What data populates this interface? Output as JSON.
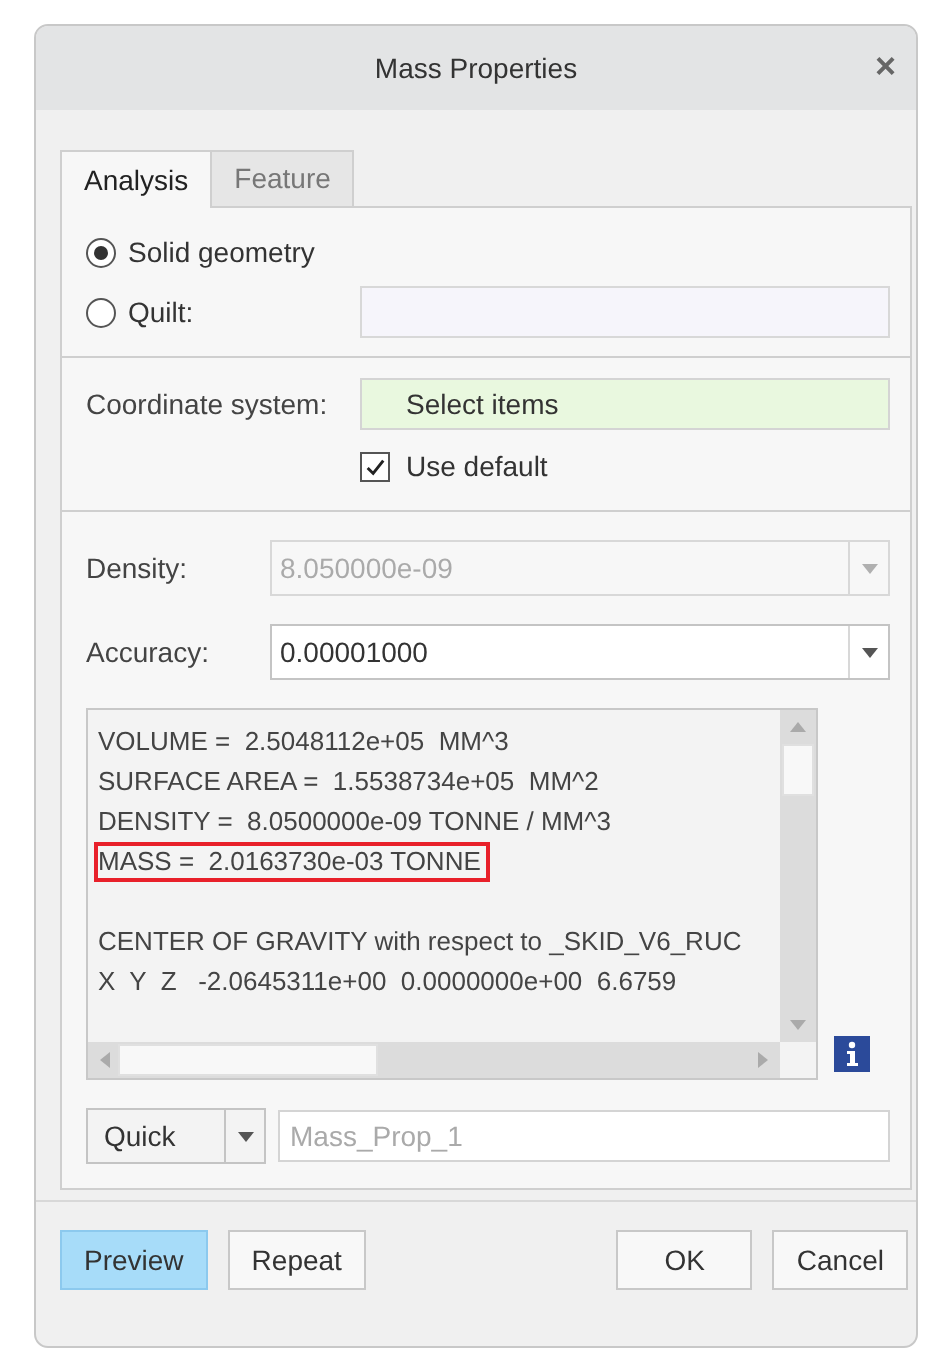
{
  "window": {
    "title": "Mass Properties",
    "close": "×"
  },
  "tabs": [
    {
      "label": "Analysis",
      "selected": true
    },
    {
      "label": "Feature",
      "selected": false
    }
  ],
  "geometry_options": [
    {
      "label": "Solid geometry",
      "selected": true
    },
    {
      "label": "Quilt:",
      "selected": false
    }
  ],
  "coordinate_system": {
    "label": "Coordinate system:",
    "value": "Select items"
  },
  "use_default": {
    "label": "Use default",
    "checked": true
  },
  "density": {
    "label": "Density:",
    "value": "8.050000e-09",
    "disabled": true
  },
  "accuracy": {
    "label": "Accuracy:",
    "value": "0.00001000",
    "disabled": false
  },
  "results": [
    {
      "lines": [
        {
          "text": "VOLUME =  2.5048112e+05  MM^3",
          "highlighted": false
        },
        {
          "text": "SURFACE AREA =  1.5538734e+05  MM^2",
          "highlighted": false
        },
        {
          "text": "DENSITY =  8.0500000e-09 TONNE / MM^3",
          "highlighted": false
        },
        {
          "text": "MASS =  2.0163730e-03 TONNE",
          "highlighted": true
        }
      ]
    },
    {
      "lines": [
        {
          "text": "CENTER OF GRAVITY with respect to _SKID_V6_RUC",
          "highlighted": false
        },
        {
          "text": "X  Y  Z   -2.0645311e+00  0.0000000e+00  6.6759",
          "highlighted": false
        }
      ]
    }
  ],
  "mode": {
    "value": "Quick"
  },
  "name_field": {
    "placeholder": "Mass_Prop_1"
  },
  "buttons": [
    {
      "label": "Preview",
      "selected": true
    },
    {
      "label": "Repeat",
      "selected": false
    },
    {
      "label": "OK",
      "selected": false
    },
    {
      "label": "Cancel",
      "selected": false
    }
  ]
}
